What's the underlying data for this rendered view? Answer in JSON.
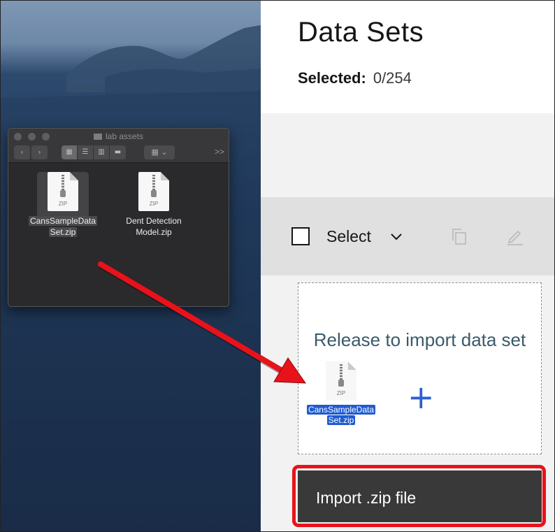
{
  "app": {
    "title": "Data Sets",
    "selected_label": "Selected:",
    "selected_value": "0/254",
    "toolbar": {
      "select_label": "Select"
    },
    "dropzone": {
      "text": "Release to import data set",
      "dragged_file_line1": "CansSampleData",
      "dragged_file_line2": "Set.zip",
      "dragged_file_type": "ZIP"
    },
    "import_button_label": "Import .zip file"
  },
  "finder": {
    "title": "lab assets",
    "toolbar": {
      "back_icon": "chevron-left",
      "forward_icon": "chevron-right",
      "more_label": ">>"
    },
    "files": [
      {
        "line1": "CansSampleData",
        "line2": "Set.zip",
        "type": "ZIP",
        "selected": true
      },
      {
        "line1": "Dent Detection",
        "line2": "Model.zip",
        "type": "ZIP",
        "selected": false
      }
    ]
  },
  "annotations": {
    "arrow_color": "#e8121a",
    "highlight_color": "#e8121a"
  },
  "colors": {
    "accent_blue": "#2f5fd0",
    "import_button_bg": "#393939",
    "drag_selection": "#1f5bd1"
  }
}
